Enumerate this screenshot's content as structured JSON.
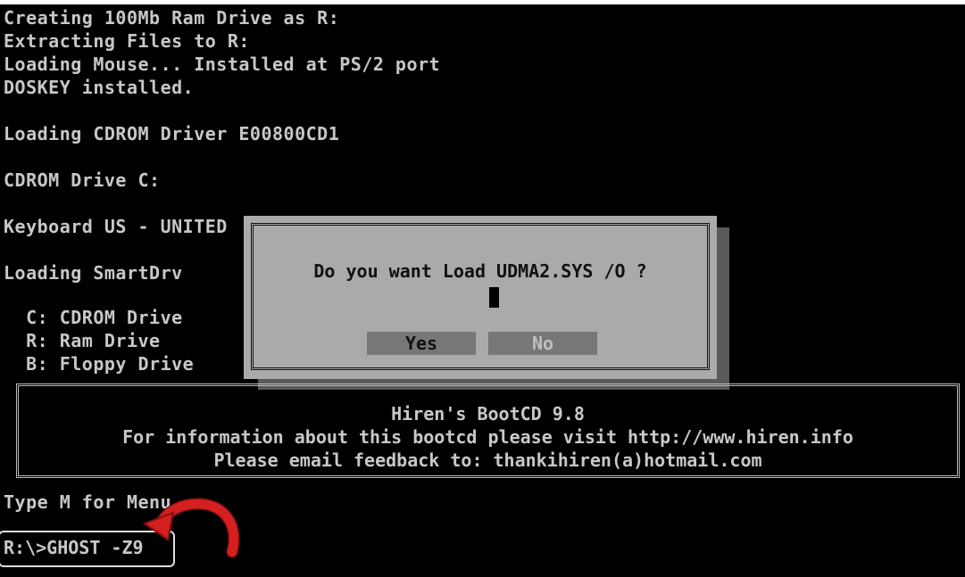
{
  "console": {
    "lines": [
      "Creating 100Mb Ram Drive as R:",
      "Extracting Files to R:",
      "Loading Mouse... Installed at PS/2 port",
      "DOSKEY installed.",
      "Loading CDROM Driver E00800CD1",
      "CDROM Drive C:",
      "Keyboard US - UNITED",
      "Loading SmartDrv",
      "  C: CDROM Drive",
      "  R: Ram Drive",
      "  B: Floppy Drive",
      "Type M for Menu"
    ],
    "command": "R:\\>GHOST -Z9"
  },
  "dialog": {
    "question": "Do you want Load UDMA2.SYS /O ?",
    "yes_label": "Yes",
    "no_label": "No"
  },
  "info": {
    "title": "Hiren's BootCD 9.8",
    "line1": "For information about this bootcd please visit http://www.hiren.info",
    "line2": "Please email feedback to: thankihiren(a)hotmail.com"
  },
  "colors": {
    "background": "#000000",
    "text": "#c8c8c8",
    "dialog": "#aaaaaa",
    "arrow": "#d42020"
  },
  "icons": {
    "arrow": "curved-arrow-icon"
  }
}
